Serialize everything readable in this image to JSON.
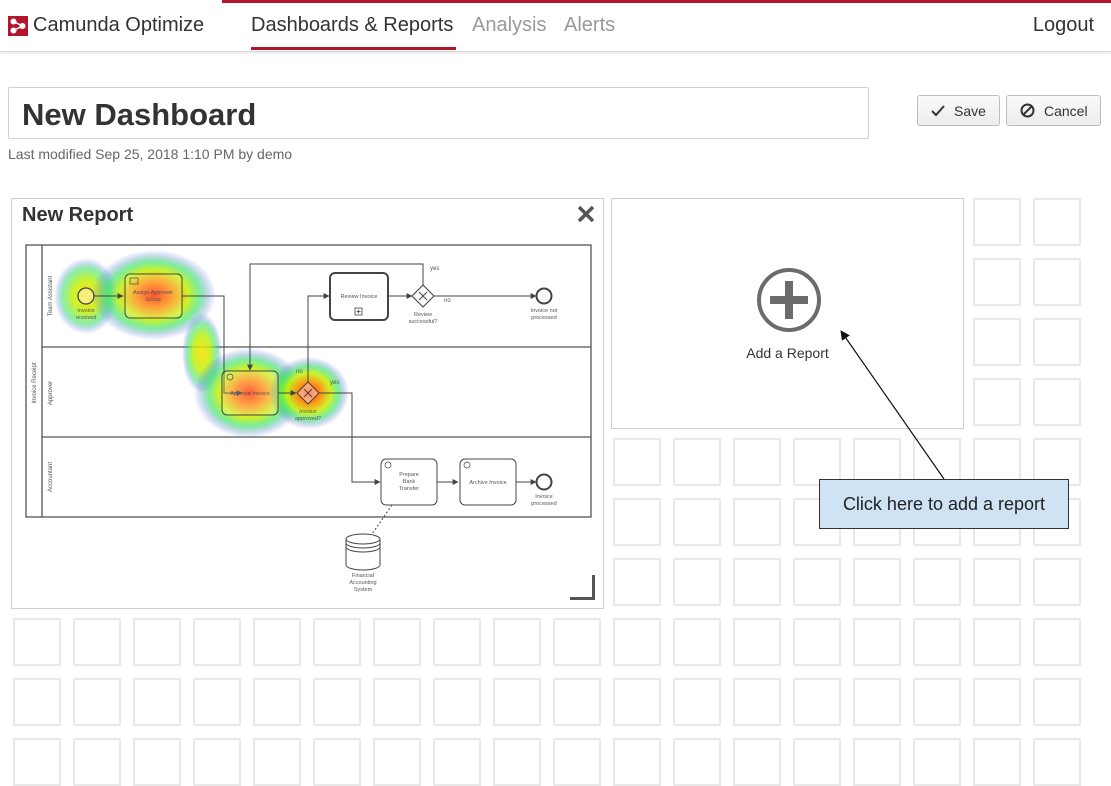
{
  "header": {
    "brand": "Camunda Optimize",
    "nav": [
      {
        "label": "Dashboards & Reports",
        "active": true
      },
      {
        "label": "Analysis",
        "active": false
      },
      {
        "label": "Alerts",
        "active": false
      }
    ],
    "logout": "Logout"
  },
  "dashboard": {
    "title": "New Dashboard",
    "modified": "Last modified Sep 25, 2018 1:10 PM by demo",
    "save_label": "Save",
    "cancel_label": "Cancel"
  },
  "report": {
    "title": "New Report",
    "diagram": {
      "pool": "Invoice Receipt",
      "lanes": [
        "Team Assistant",
        "Approver",
        "Accountant"
      ],
      "nodes": {
        "invoice_received": [
          "Invoice",
          "received"
        ],
        "assign_approver": [
          "Assign Approver",
          "Group"
        ],
        "review_invoice": "Review Invoice",
        "review_successful": [
          "Review",
          "successful?"
        ],
        "invoice_not_processed": [
          "Invoice not",
          "processed"
        ],
        "approve_invoice": "Approve Invoice",
        "invoice_approved": [
          "Invoice",
          "approved?"
        ],
        "prepare_bank_transfer": [
          "Prepare",
          "Bank",
          "Transfer"
        ],
        "archive_invoice": "Archive Invoice",
        "invoice_processed": [
          "Invoice",
          "processed"
        ],
        "financial_accounting_system": [
          "Financial",
          "Accounting",
          "System"
        ]
      },
      "flow_labels": {
        "yes_top": "yes",
        "no_top": "no",
        "no_mid": "no",
        "yes_mid": "yes"
      }
    }
  },
  "add_report": {
    "label": "Add a Report"
  },
  "tooltip": {
    "text": "Click here to add a report"
  },
  "colors": {
    "accent": "#b5152b",
    "tooltip_bg": "#cfe3f5",
    "grid": "#e9e9e9"
  },
  "icons": [
    "camunda-logo-icon",
    "check-icon",
    "cancel-circle-icon",
    "close-icon",
    "plus-circle-icon",
    "resize-handle-icon"
  ]
}
